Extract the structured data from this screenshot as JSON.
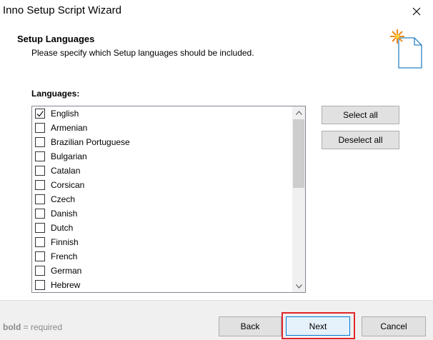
{
  "window": {
    "title": "Inno Setup Script Wizard"
  },
  "header": {
    "title": "Setup Languages",
    "subtitle": "Please specify which Setup languages should be included."
  },
  "main": {
    "languages_label": "Languages:",
    "items": [
      {
        "label": "English",
        "checked": true
      },
      {
        "label": "Armenian",
        "checked": false
      },
      {
        "label": "Brazilian Portuguese",
        "checked": false
      },
      {
        "label": "Bulgarian",
        "checked": false
      },
      {
        "label": "Catalan",
        "checked": false
      },
      {
        "label": "Corsican",
        "checked": false
      },
      {
        "label": "Czech",
        "checked": false
      },
      {
        "label": "Danish",
        "checked": false
      },
      {
        "label": "Dutch",
        "checked": false
      },
      {
        "label": "Finnish",
        "checked": false
      },
      {
        "label": "French",
        "checked": false
      },
      {
        "label": "German",
        "checked": false
      },
      {
        "label": "Hebrew",
        "checked": false
      }
    ],
    "select_all_label": "Select all",
    "deselect_all_label": "Deselect all"
  },
  "footer": {
    "hint_bold": "bold",
    "hint_rest": " = required",
    "back_label": "Back",
    "next_label": "Next",
    "cancel_label": "Cancel"
  },
  "colors": {
    "highlight": "#e0262b",
    "accent": "#0078d7"
  },
  "icons": {
    "close": "close-icon",
    "wizard": "wizard-document-icon",
    "check": "checkmark-icon"
  }
}
